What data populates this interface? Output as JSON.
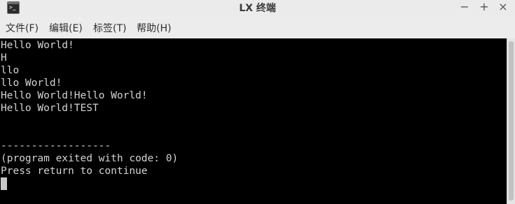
{
  "window": {
    "title": "LX 终端",
    "app_icon": "terminal-icon",
    "prompt_glyph": ">_",
    "controls": {
      "minimize": "−",
      "maximize": "+",
      "close": "×"
    }
  },
  "menu": {
    "file": "文件(F)",
    "edit": "编辑(E)",
    "tabs": "标签(T)",
    "help": "帮助(H)"
  },
  "terminal": {
    "lines": [
      "Hello World!",
      "H",
      "llo",
      "llo World!",
      "Hello World!Hello World!",
      "Hello World!TEST",
      "",
      "",
      "------------------",
      "(program exited with code: 0)",
      "Press return to continue"
    ],
    "colors": {
      "background": "#000000",
      "foreground": "#d3d3d3"
    }
  }
}
